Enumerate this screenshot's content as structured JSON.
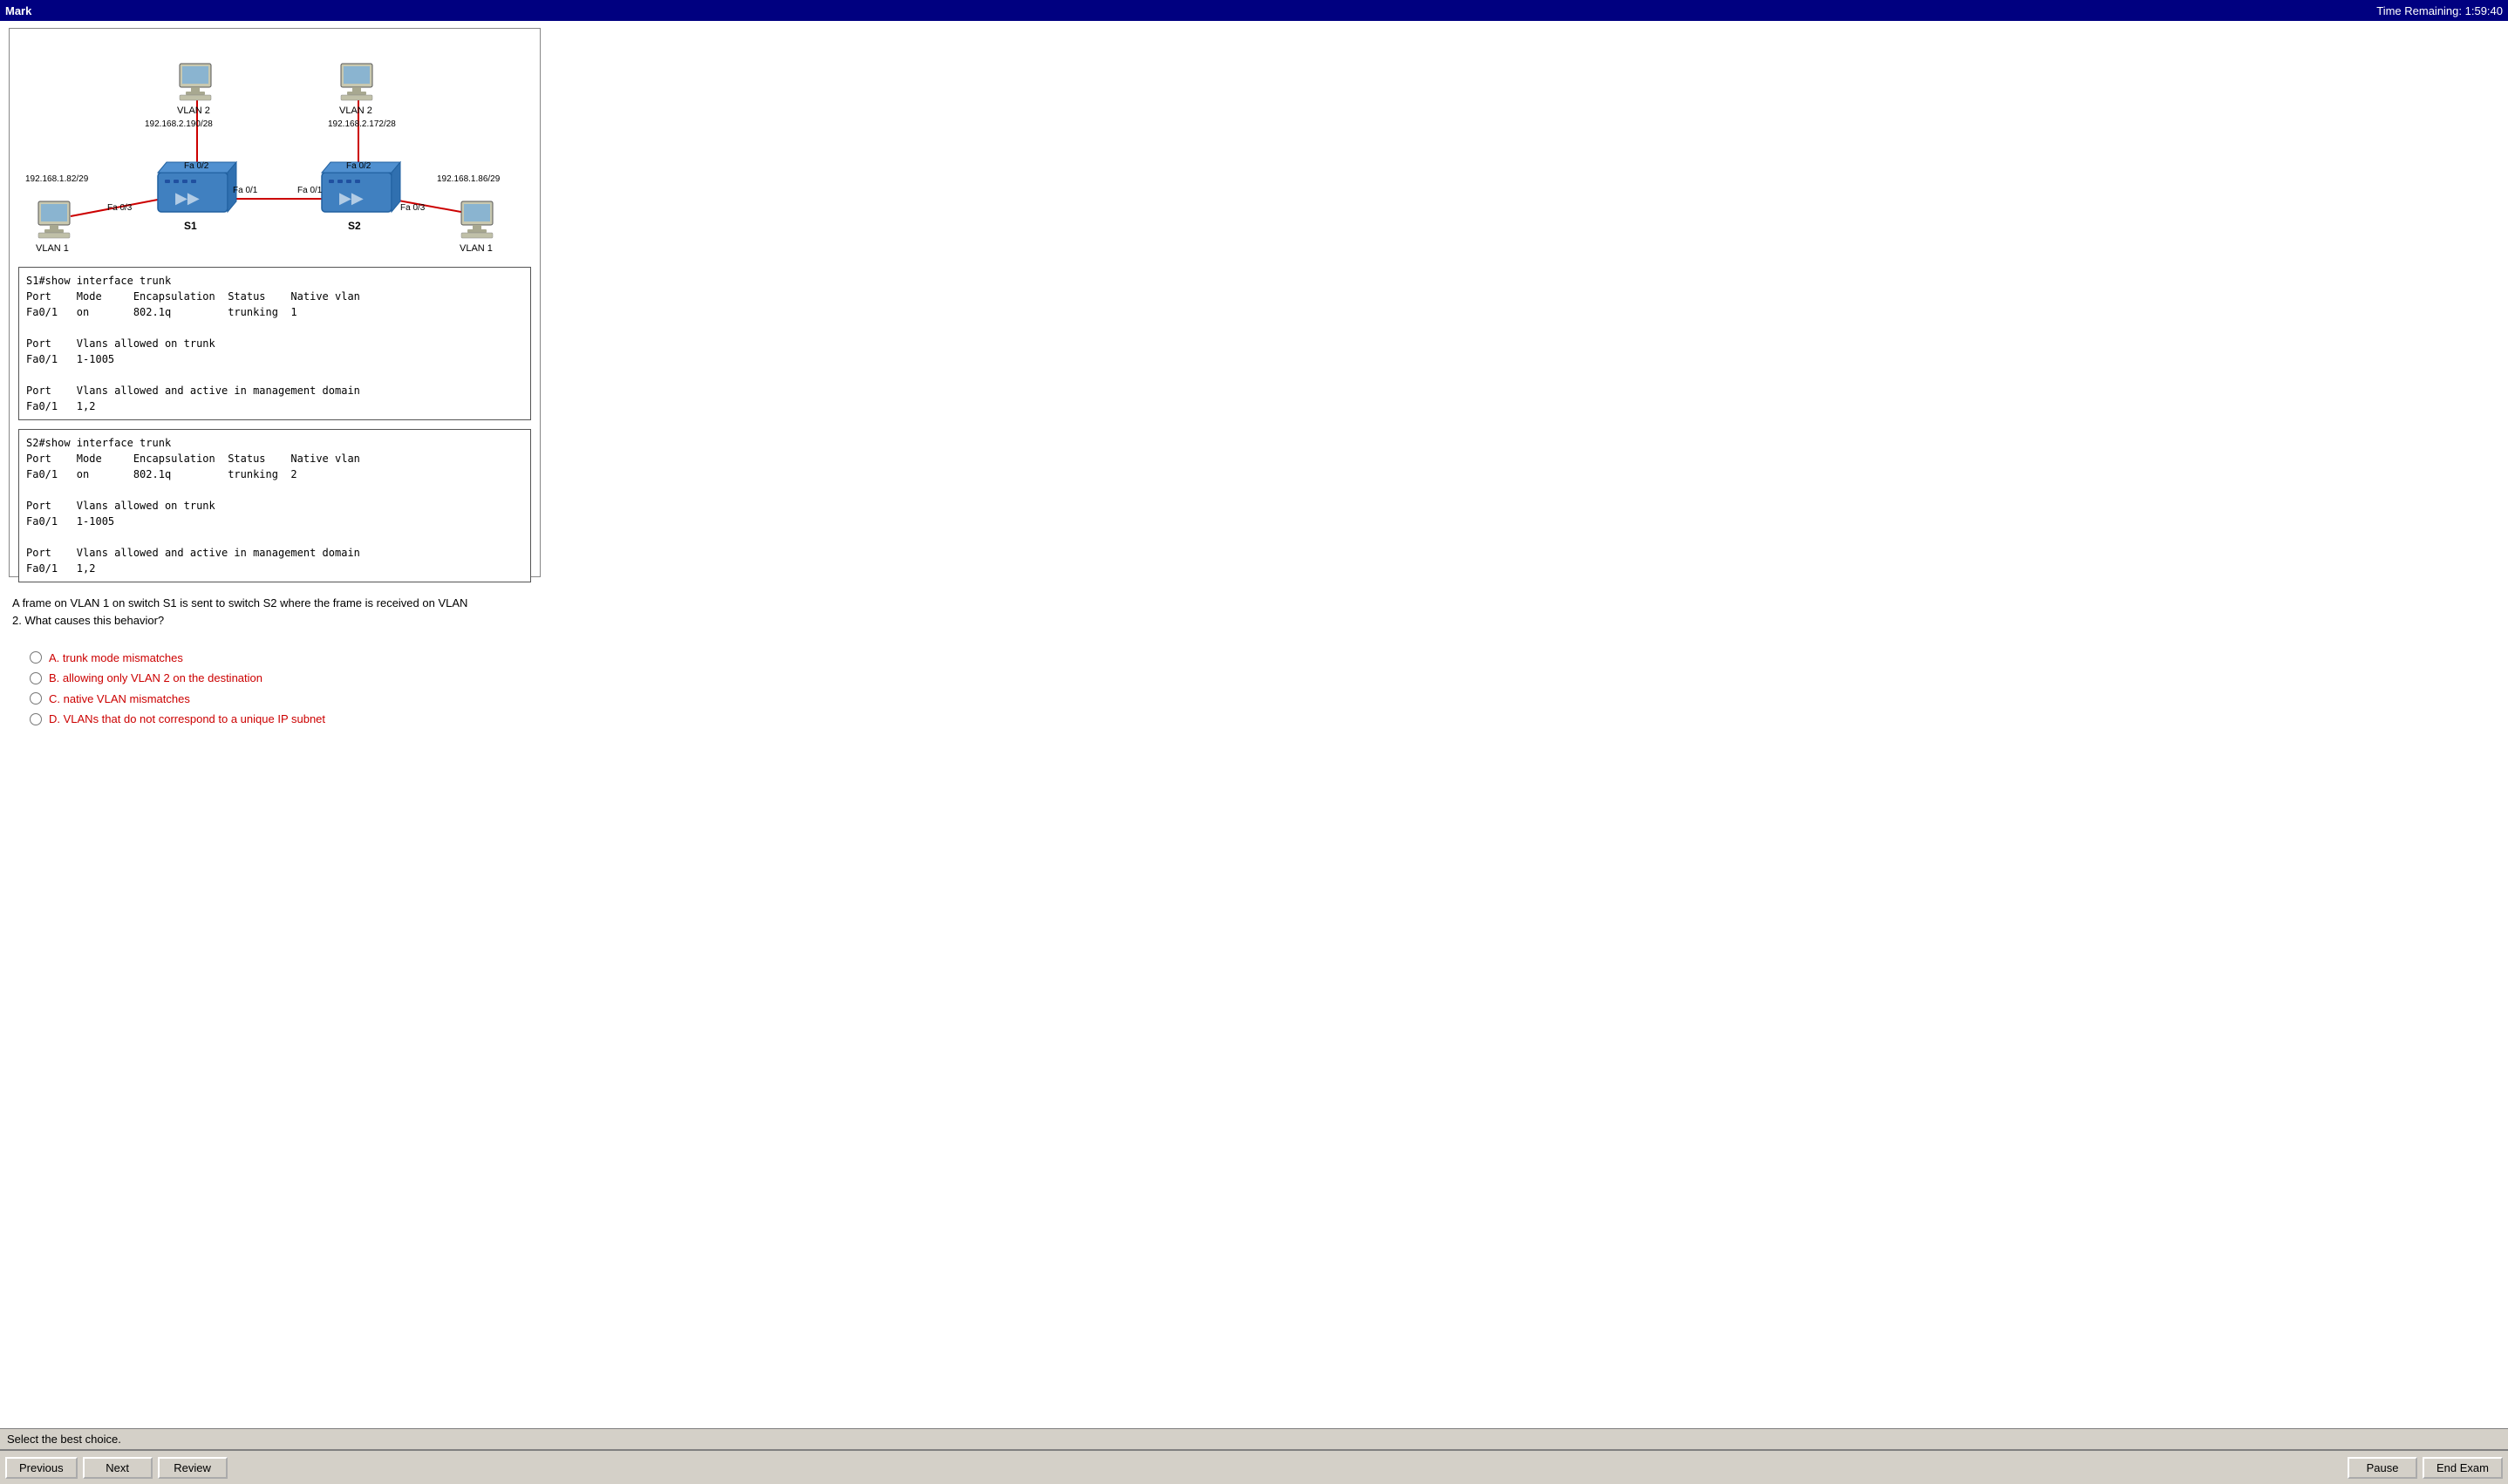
{
  "titleBar": {
    "title": "Mark",
    "timeRemaining": "Time Remaining: 1:59:40"
  },
  "diagram": {
    "s1Label": "S1",
    "s2Label": "S2",
    "vlan2Left": "VLAN 2",
    "vlan2Right": "VLAN 2",
    "vlan1Left": "VLAN 1",
    "vlan1Right": "VLAN 1",
    "ip1": "192.168.2.190/28",
    "ip2": "192.168.2.172/28",
    "ip3": "192.168.1.82/29",
    "ip4": "192.168.1.86/29",
    "fa02_s1": "Fa 0/2",
    "fa02_s2": "Fa 0/2",
    "fa01_s1_left": "Fa 0/3",
    "fa01_s1_right": "Fa 0/1",
    "fa01_s2_left": "Fa 0/1",
    "fa01_s2_right": "Fa 0/3"
  },
  "s1Console": {
    "command": "S1#show interface trunk",
    "header": "Port    Mode     Encapsulation  Status    Native vlan",
    "row1": "Fa0/1   on       802.1q         trunking  1",
    "blank1": "",
    "vlansHeader": "Port    Vlans allowed on trunk",
    "vlansRow": "Fa0/1   1-1005",
    "blank2": "",
    "activeHeader": "Port    Vlans allowed and active in management domain",
    "activeRow": "Fa0/1   1,2"
  },
  "s2Console": {
    "command": "S2#show interface trunk",
    "header": "Port    Mode     Encapsulation  Status    Native vlan",
    "row1": "Fa0/1   on       802.1q         trunking  2",
    "blank1": "",
    "vlansHeader": "Port    Vlans allowed on trunk",
    "vlansRow": "Fa0/1   1-1005",
    "blank2": "",
    "activeHeader": "Port    Vlans allowed and active in management domain",
    "activeRow": "Fa0/1   1,2"
  },
  "question": {
    "text": "A frame on VLAN 1 on switch S1 is sent to switch S2 where the frame is received on VLAN\n2. What causes this behavior?",
    "choices": [
      {
        "id": "A",
        "text": "A.  trunk mode mismatches"
      },
      {
        "id": "B",
        "text": "B.  allowing only VLAN 2 on the destination"
      },
      {
        "id": "C",
        "text": "C.  native VLAN mismatches"
      },
      {
        "id": "D",
        "text": "D.  VLANs that do not correspond to a unique IP subnet"
      }
    ]
  },
  "statusBar": {
    "text": "Select the best choice."
  },
  "buttons": {
    "previous": "Previous",
    "next": "Next",
    "review": "Review",
    "pause": "Pause",
    "endExam": "End Exam"
  }
}
